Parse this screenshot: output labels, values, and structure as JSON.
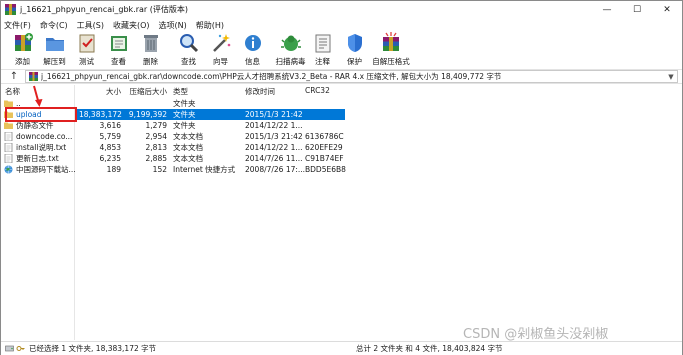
{
  "window": {
    "title": "j_16621_phpyun_rencai_gbk.rar (评估版本)"
  },
  "menu": [
    "文件(F)",
    "命令(C)",
    "工具(S)",
    "收藏夹(O)",
    "选项(N)",
    "帮助(H)"
  ],
  "toolbar": [
    {
      "label": "添加",
      "icon": "add-archive-icon"
    },
    {
      "label": "解压到",
      "icon": "extract-folder-icon"
    },
    {
      "label": "测试",
      "icon": "test-clipboard-icon"
    },
    {
      "label": "查看",
      "icon": "view-book-icon"
    },
    {
      "label": "删除",
      "icon": "trash-icon"
    },
    {
      "label": "查找",
      "icon": "magnifier-icon"
    },
    {
      "label": "向导",
      "icon": "wand-icon"
    },
    {
      "label": "信息",
      "icon": "info-icon"
    },
    {
      "label": "扫描病毒",
      "icon": "virus-scan-icon"
    },
    {
      "label": "注释",
      "icon": "comment-icon"
    },
    {
      "label": "保护",
      "icon": "shield-icon"
    },
    {
      "label": "自解压格式",
      "icon": "sfx-icon"
    }
  ],
  "address": {
    "path": "j_16621_phpyun_rencai_gbk.rar\\downcode.com\\PHP云人才招聘系统V3.2_Beta - RAR 4.x 压缩文件, 解包大小为 18,409,772 字节"
  },
  "columns": {
    "name": "名称",
    "size": "大小",
    "packed": "压缩后大小",
    "type": "类型",
    "modified": "修改时间",
    "crc": "CRC32"
  },
  "rows": [
    {
      "name": "..",
      "size": "",
      "packed": "",
      "type": "文件夹",
      "modified": "",
      "crc": "",
      "icon": "folder-icon"
    },
    {
      "name": "upload",
      "size": "18,383,172",
      "packed": "9,199,392",
      "type": "文件夹",
      "modified": "2015/1/3 21:42",
      "crc": "",
      "icon": "folder-icon",
      "selected": true
    },
    {
      "name": "伪静态文件",
      "size": "3,616",
      "packed": "1,279",
      "type": "文件夹",
      "modified": "2014/12/22 1...",
      "crc": "",
      "icon": "folder-icon"
    },
    {
      "name": "downcode.co...",
      "size": "5,759",
      "packed": "2,954",
      "type": "文本文档",
      "modified": "2015/1/3 21:42",
      "crc": "6136786C",
      "icon": "text-file-icon"
    },
    {
      "name": "install说明.txt",
      "size": "4,853",
      "packed": "2,813",
      "type": "文本文档",
      "modified": "2014/12/22 1...",
      "crc": "620EFE29",
      "icon": "text-file-icon"
    },
    {
      "name": "更新日志.txt",
      "size": "6,235",
      "packed": "2,885",
      "type": "文本文档",
      "modified": "2014/7/26 11...",
      "crc": "C91B74EF",
      "icon": "text-file-icon"
    },
    {
      "name": "中国源码下载站...",
      "size": "189",
      "packed": "152",
      "type": "Internet 快捷方式",
      "modified": "2008/7/26 17:...",
      "crc": "BDD5E6B8",
      "icon": "globe-icon"
    }
  ],
  "status": {
    "left": "已经选择 1 文件夹, 18,383,172 字节",
    "right": "总计 2 文件夹 和 4 文件, 18,403,824 字节"
  },
  "watermark": "CSDN @剁椒鱼头没剁椒",
  "colors": {
    "selection": "#0078d7",
    "annotation_red": "#e02020"
  }
}
